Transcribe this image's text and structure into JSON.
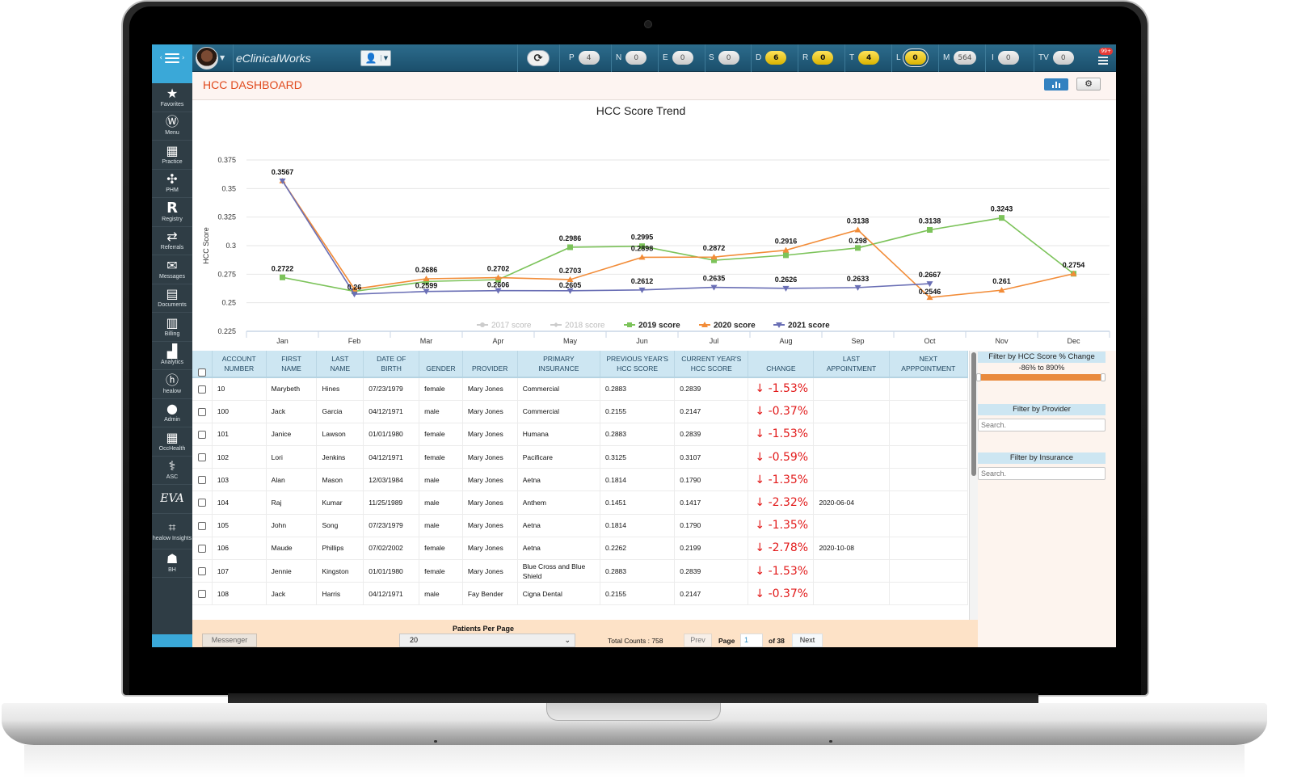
{
  "app": {
    "brand": "eClinicalWorks",
    "page_title": "HCC DASHBOARD"
  },
  "topbar": {
    "jellybeans": [
      {
        "key": "P",
        "count": "4",
        "style": "gray"
      },
      {
        "key": "N",
        "count": "0",
        "style": "gray"
      },
      {
        "key": "E",
        "count": "0",
        "style": "gray"
      },
      {
        "key": "S",
        "count": "0",
        "style": "gray"
      },
      {
        "key": "D",
        "count": "6",
        "style": "yellow"
      },
      {
        "key": "R",
        "count": "0",
        "style": "yellow"
      },
      {
        "key": "T",
        "count": "4",
        "style": "yellow"
      },
      {
        "key": "L",
        "count": "0",
        "style": "yellow-ring"
      },
      {
        "key": "M",
        "count": "564",
        "style": "gray"
      },
      {
        "key": "I",
        "count": "0",
        "style": "gray"
      },
      {
        "key": "TV",
        "count": "0",
        "style": "gray"
      }
    ],
    "alerts_badge": "99+",
    "icons": {
      "menu": "hamburger-icon",
      "avatar": "user-avatar",
      "patient_search": "patient-search-icon",
      "refresh": "refresh-icon",
      "alerts": "alerts-list-icon"
    }
  },
  "sidebar": {
    "items": [
      {
        "label": "Favorites",
        "icon": "★",
        "name": "star-icon"
      },
      {
        "label": "Menu",
        "icon": "Ⓦ",
        "name": "ecw-logo-icon"
      },
      {
        "label": "Practice",
        "icon": "▦",
        "name": "building-icon"
      },
      {
        "label": "PHM",
        "icon": "✣",
        "name": "phm-icon"
      },
      {
        "label": "Registry",
        "icon": "R",
        "name": "registry-icon"
      },
      {
        "label": "Referrals",
        "icon": "⇄",
        "name": "arrows-exchange-icon"
      },
      {
        "label": "Messages",
        "icon": "✉",
        "name": "envelope-icon"
      },
      {
        "label": "Documents",
        "icon": "▤",
        "name": "documents-icon"
      },
      {
        "label": "Billing",
        "icon": "▥",
        "name": "billing-receipt-icon"
      },
      {
        "label": "Analytics",
        "icon": "▟",
        "name": "analytics-chart-icon"
      },
      {
        "label": "healow",
        "icon": "ⓗ",
        "name": "healow-icon"
      },
      {
        "label": "Admin",
        "icon": "●",
        "name": "admin-user-icon"
      },
      {
        "label": "OccHealth",
        "icon": "▦",
        "name": "occhealth-building-icon"
      },
      {
        "label": "ASC",
        "icon": "⚕",
        "name": "asc-surgery-icon"
      },
      {
        "label": "",
        "icon": "EVA",
        "name": "eva-logo-icon"
      },
      {
        "label": "healow Insights",
        "icon": "⌗",
        "name": "healow-insights-icon"
      },
      {
        "label": "BH",
        "icon": "☗",
        "name": "behavioral-health-head-icon"
      }
    ]
  },
  "header_buttons": {
    "chart_view": "bar-chart-icon",
    "settings": "gear-icon",
    "settings_glyph": "⚙"
  },
  "chart_data": {
    "type": "line",
    "title": "HCC Score Trend",
    "xlabel": "",
    "ylabel": "HCC Score",
    "categories": [
      "Jan",
      "Feb",
      "Mar",
      "Apr",
      "May",
      "Jun",
      "Jul",
      "Aug",
      "Sep",
      "Oct",
      "Nov",
      "Dec"
    ],
    "ylim": [
      0.225,
      0.375
    ],
    "yticks": [
      0.225,
      0.25,
      0.275,
      0.3,
      0.325,
      0.35,
      0.375
    ],
    "ytick_labels": [
      "0.225",
      "0.25",
      "0.275",
      "0.3",
      "0.325",
      "0.35",
      "0.375"
    ],
    "grid": true,
    "legend_position": "bottom-center",
    "series": [
      {
        "name": "2017 score",
        "color": "#c8c8c8",
        "marker": "circle",
        "visible": false,
        "values": []
      },
      {
        "name": "2018 score",
        "color": "#c8c8c8",
        "marker": "diamond",
        "visible": false,
        "values": []
      },
      {
        "name": "2019 score",
        "color": "#7cc35a",
        "marker": "square",
        "visible": true,
        "values": [
          0.2722,
          0.26,
          0.2686,
          0.2702,
          0.2986,
          0.2995,
          0.2872,
          0.2916,
          0.298,
          0.3138,
          0.3243,
          0.2754
        ]
      },
      {
        "name": "2020 score",
        "color": "#f28c38",
        "marker": "triangle-up",
        "visible": true,
        "values": [
          0.3567,
          0.262,
          0.271,
          0.272,
          0.2703,
          0.2898,
          0.29,
          0.296,
          0.3138,
          0.2546,
          0.261,
          0.2754
        ]
      },
      {
        "name": "2021 score",
        "color": "#6a6fb5",
        "marker": "triangle-down",
        "visible": true,
        "values": [
          0.3567,
          0.2575,
          0.2599,
          0.2606,
          0.2605,
          0.2612,
          0.2635,
          0.2626,
          0.2633,
          0.2667,
          null,
          null
        ]
      }
    ],
    "data_labels": [
      {
        "x": "Jan",
        "value": "0.3567",
        "series": "2021 score"
      },
      {
        "x": "Jan",
        "value": "0.2722",
        "series": "2019 score"
      },
      {
        "x": "Feb",
        "value": "0.26",
        "series": "2019 score"
      },
      {
        "x": "Mar",
        "value": "0.2686",
        "series": "2020 score"
      },
      {
        "x": "Mar",
        "value": "0.2599",
        "series": "2021 score"
      },
      {
        "x": "Apr",
        "value": "0.2702",
        "series": "2020 score"
      },
      {
        "x": "Apr",
        "value": "0.2606",
        "series": "2021 score"
      },
      {
        "x": "May",
        "value": "0.2986",
        "series": "2019 score"
      },
      {
        "x": "May",
        "value": "0.2703",
        "series": "2020 score"
      },
      {
        "x": "May",
        "value": "0.2605",
        "series": "2021 score"
      },
      {
        "x": "Jun",
        "value": "0.2995",
        "series": "2019 score"
      },
      {
        "x": "Jun",
        "value": "0.2898",
        "series": "2020 score"
      },
      {
        "x": "Jun",
        "value": "0.2612",
        "series": "2021 score"
      },
      {
        "x": "Jul",
        "value": "0.2872",
        "series": "2020 score"
      },
      {
        "x": "Jul",
        "value": "0.2635",
        "series": "2021 score"
      },
      {
        "x": "Aug",
        "value": "0.2916",
        "series": "2020 score"
      },
      {
        "x": "Aug",
        "value": "0.2626",
        "series": "2021 score"
      },
      {
        "x": "Sep",
        "value": "0.3138",
        "series": "2020 score"
      },
      {
        "x": "Sep",
        "value": "0.298",
        "series": "2019 score"
      },
      {
        "x": "Sep",
        "value": "0.2633",
        "series": "2021 score"
      },
      {
        "x": "Oct",
        "value": "0.3138",
        "series": "2019 score"
      },
      {
        "x": "Oct",
        "value": "0.2667",
        "series": "2021 score"
      },
      {
        "x": "Oct",
        "value": "0.2546",
        "series": "2020 score"
      },
      {
        "x": "Nov",
        "value": "0.3243",
        "series": "2019 score"
      },
      {
        "x": "Nov",
        "value": "0.261",
        "series": "2020 score"
      },
      {
        "x": "Dec",
        "value": "0.2754",
        "series": "2020 score"
      }
    ]
  },
  "table": {
    "columns": [
      "ACCOUNT NUMBER",
      "FIRST NAME",
      "LAST NAME",
      "DATE OF BIRTH",
      "GENDER",
      "PROVIDER",
      "PRIMARY INSURANCE",
      "PREVIOUS YEAR'S HCC SCORE",
      "CURRENT YEAR'S HCC SCORE",
      "CHANGE",
      "LAST APPOINTMENT",
      "NEXT APPPOINTMENT"
    ],
    "column_lines": [
      [
        "ACCOUNT",
        "NUMBER"
      ],
      [
        "FIRST",
        "NAME"
      ],
      [
        "LAST",
        "NAME"
      ],
      [
        "DATE OF",
        "BIRTH"
      ],
      [
        "",
        "GENDER"
      ],
      [
        "",
        "PROVIDER"
      ],
      [
        "PRIMARY",
        "INSURANCE"
      ],
      [
        "PREVIOUS YEAR'S",
        "HCC SCORE"
      ],
      [
        "CURRENT YEAR'S",
        "HCC SCORE"
      ],
      [
        "",
        "CHANGE"
      ],
      [
        "LAST",
        "APPOINTMENT"
      ],
      [
        "NEXT",
        "APPPOINTMENT"
      ]
    ],
    "rows": [
      {
        "account": "10",
        "first": "Marybeth",
        "last": "Hines",
        "dob": "07/23/1979",
        "gender": "female",
        "provider": "Mary Jones",
        "insurance": "Commercial",
        "prev": "0.2883",
        "curr": "0.2839",
        "change": "↓ -1.53%",
        "last_appt": "",
        "next_appt": ""
      },
      {
        "account": "100",
        "first": "Jack",
        "last": "Garcia",
        "dob": "04/12/1971",
        "gender": "male",
        "provider": "Mary Jones",
        "insurance": "Commercial",
        "prev": "0.2155",
        "curr": "0.2147",
        "change": "↓ -0.37%",
        "last_appt": "",
        "next_appt": ""
      },
      {
        "account": "101",
        "first": "Janice",
        "last": "Lawson",
        "dob": "01/01/1980",
        "gender": "female",
        "provider": "Mary Jones",
        "insurance": "Humana",
        "prev": "0.2883",
        "curr": "0.2839",
        "change": "↓ -1.53%",
        "last_appt": "",
        "next_appt": ""
      },
      {
        "account": "102",
        "first": "Lori",
        "last": "Jenkins",
        "dob": "04/12/1971",
        "gender": "female",
        "provider": "Mary Jones",
        "insurance": "Pacificare",
        "prev": "0.3125",
        "curr": "0.3107",
        "change": "↓ -0.59%",
        "last_appt": "",
        "next_appt": ""
      },
      {
        "account": "103",
        "first": "Alan",
        "last": "Mason",
        "dob": "12/03/1984",
        "gender": "male",
        "provider": "Mary Jones",
        "insurance": "Aetna",
        "prev": "0.1814",
        "curr": "0.1790",
        "change": "↓ -1.35%",
        "last_appt": "",
        "next_appt": ""
      },
      {
        "account": "104",
        "first": "Raj",
        "last": "Kumar",
        "dob": "11/25/1989",
        "gender": "male",
        "provider": "Mary Jones",
        "insurance": "Anthem",
        "prev": "0.1451",
        "curr": "0.1417",
        "change": "↓ -2.32%",
        "last_appt": "2020-06-04",
        "next_appt": ""
      },
      {
        "account": "105",
        "first": "John",
        "last": "Song",
        "dob": "07/23/1979",
        "gender": "male",
        "provider": "Mary Jones",
        "insurance": "Aetna",
        "prev": "0.1814",
        "curr": "0.1790",
        "change": "↓ -1.35%",
        "last_appt": "",
        "next_appt": ""
      },
      {
        "account": "106",
        "first": "Maude",
        "last": "Phillips",
        "dob": "07/02/2002",
        "gender": "female",
        "provider": "Mary Jones",
        "insurance": "Aetna",
        "prev": "0.2262",
        "curr": "0.2199",
        "change": "↓ -2.78%",
        "last_appt": "2020-10-08",
        "next_appt": ""
      },
      {
        "account": "107",
        "first": "Jennie",
        "last": "Kingston",
        "dob": "01/01/1980",
        "gender": "female",
        "provider": "Mary Jones",
        "insurance": "Blue Cross and Blue Shield",
        "prev": "0.2883",
        "curr": "0.2839",
        "change": "↓ -1.53%",
        "last_appt": "",
        "next_appt": ""
      },
      {
        "account": "108",
        "first": "Jack",
        "last": "Harris",
        "dob": "04/12/1971",
        "gender": "male",
        "provider": "Fay Bender",
        "insurance": "Cigna Dental",
        "prev": "0.2155",
        "curr": "0.2147",
        "change": "↓ -0.37%",
        "last_appt": "",
        "next_appt": ""
      }
    ],
    "change_color": "#e21b1b"
  },
  "filters": {
    "hcc_change": {
      "title": "Filter by HCC Score % Change",
      "range_text": "-86% to 890%",
      "min_percent": -86,
      "max_percent": 890
    },
    "provider": {
      "title": "Filter by Provider",
      "placeholder": "Search."
    },
    "insurance": {
      "title": "Filter by Insurance",
      "placeholder": "Search."
    }
  },
  "footer": {
    "messenger": "Messenger",
    "patients_per_page_label": "Patients Per Page",
    "patients_per_page_value": "20",
    "total_counts": "Total Counts : 758",
    "prev": "Prev",
    "page_label": "Page",
    "page_value": "1",
    "of_label": "of 38",
    "next": "Next"
  }
}
